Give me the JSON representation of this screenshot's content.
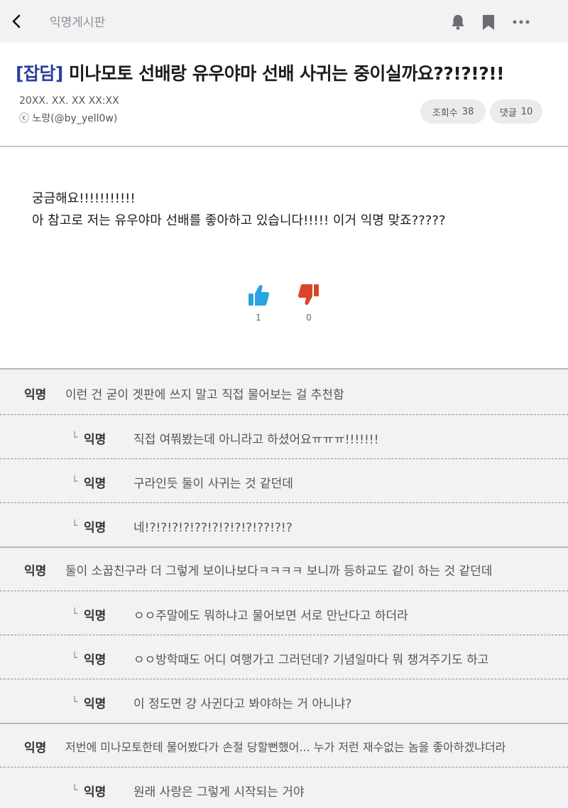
{
  "header": {
    "board_name": "익명게시판",
    "icons": [
      "back-arrow-icon",
      "bell-icon",
      "bookmark-icon",
      "more-icon"
    ]
  },
  "post": {
    "tag": "[잡담]",
    "title": "미나모토 선배랑 유우야마 선배 사귀는 중이실까요??!?!?!!",
    "date": "20XX. XX. XX   XX:XX",
    "author": "ⓒ 노랑(@by_yell0w)",
    "views_label": "조회수",
    "views": "38",
    "comments_label": "댓글",
    "comments_count": "10",
    "body_line1": "궁금해요!!!!!!!!!!!",
    "body_line2": "아 참고로 저는 유우야마 선배를 좋아하고 있습니다!!!!! 이거 익명 맞죠?????",
    "likes": "1",
    "dislikes": "0"
  },
  "colors": {
    "tag": "#2c3f9f",
    "like": "#2aa3e0",
    "dislike": "#d9452b"
  },
  "reply_marker": "└",
  "comments": [
    {
      "author": "익명",
      "text": "이런 건 굳이 겟판에 쓰지 말고 직접 물어보는 걸 추천함"
    },
    {
      "author": "익명",
      "text": "직접 여쭤봤는데 아니라고 하셨어요ㅠㅠㅠ!!!!!!!"
    },
    {
      "author": "익명",
      "text": "구라인듯 둘이 사귀는 것 같던데"
    },
    {
      "author": "익명",
      "text": "네!?!?!?!?!??!?!?!?!?!??!?!?"
    },
    {
      "author": "익명",
      "text": "둘이 소꿉친구라 더 그렇게 보이나보다ㅋㅋㅋㅋ 보니까 등하교도 같이 하는 것 같던데"
    },
    {
      "author": "익명",
      "text": "ㅇㅇ주말에도 뭐하냐고 물어보면 서로 만난다고 하더라"
    },
    {
      "author": "익명",
      "text": "ㅇㅇ방학때도 어디 여행가고 그러던데? 기념일마다 뭐 챙겨주기도 하고"
    },
    {
      "author": "익명",
      "text": "이 정도면 걍 사귄다고 봐야하는 거 아니냐?"
    },
    {
      "author": "익명",
      "text": "저번에 미나모토한테 물어봤다가 손절 당할뻔했어... 누가 저런 재수없는 놈을 좋아하겠냐더라"
    },
    {
      "author": "익명",
      "text": "원래 사랑은 그렇게 시작되는 거야"
    }
  ]
}
